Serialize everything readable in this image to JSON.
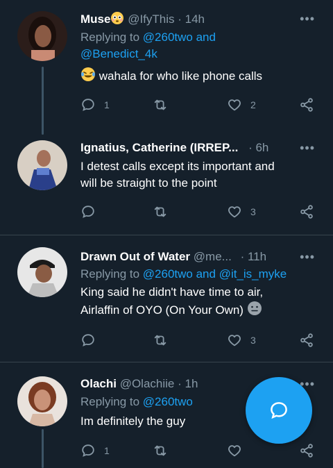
{
  "colors": {
    "background": "#15202b",
    "accent": "#1da1f2",
    "muted": "#8899a6",
    "divider": "#38444d"
  },
  "tweets": [
    {
      "name": "Muse",
      "name_emoji": "flushed-face-emoji",
      "handle": "@IfyThis",
      "time": "· 14h",
      "replying_prefix": "Replying to",
      "mentions_line1": "@260two and",
      "mentions_line2": "@Benedict_4k",
      "text_emoji": "laughing-tears-emoji",
      "text": "wahala for who like phone calls",
      "replies": "1",
      "retweets": "",
      "likes": "2"
    },
    {
      "name": "Ignatius, Catherine (IRREP...",
      "handle": "",
      "time": "· 6h",
      "text_line1": "I detest calls except its important and",
      "text_line2": "will be straight to the point",
      "replies": "",
      "retweets": "",
      "likes": "3"
    },
    {
      "name": "Drawn Out of Water",
      "handle": "@me...",
      "time": "· 11h",
      "replying_prefix": "Replying to",
      "mentions": "@260two and @it_is_myke",
      "text_line1": "King said he didn't have time to air,",
      "text_line2": "Airlaffin of OYO (On Your Own)",
      "text_emoji": "neutral-face-emoji",
      "replies": "",
      "retweets": "",
      "likes": "3"
    },
    {
      "name": "Olachi",
      "handle": "@Olachiie",
      "time": "· 1h",
      "replying_prefix": "Replying to",
      "mentions": "@260two",
      "text": "Im definitely the guy",
      "replies": "1",
      "retweets": "",
      "likes": ""
    }
  ],
  "more_label": "•••",
  "fab_icon": "compose-reply-icon"
}
